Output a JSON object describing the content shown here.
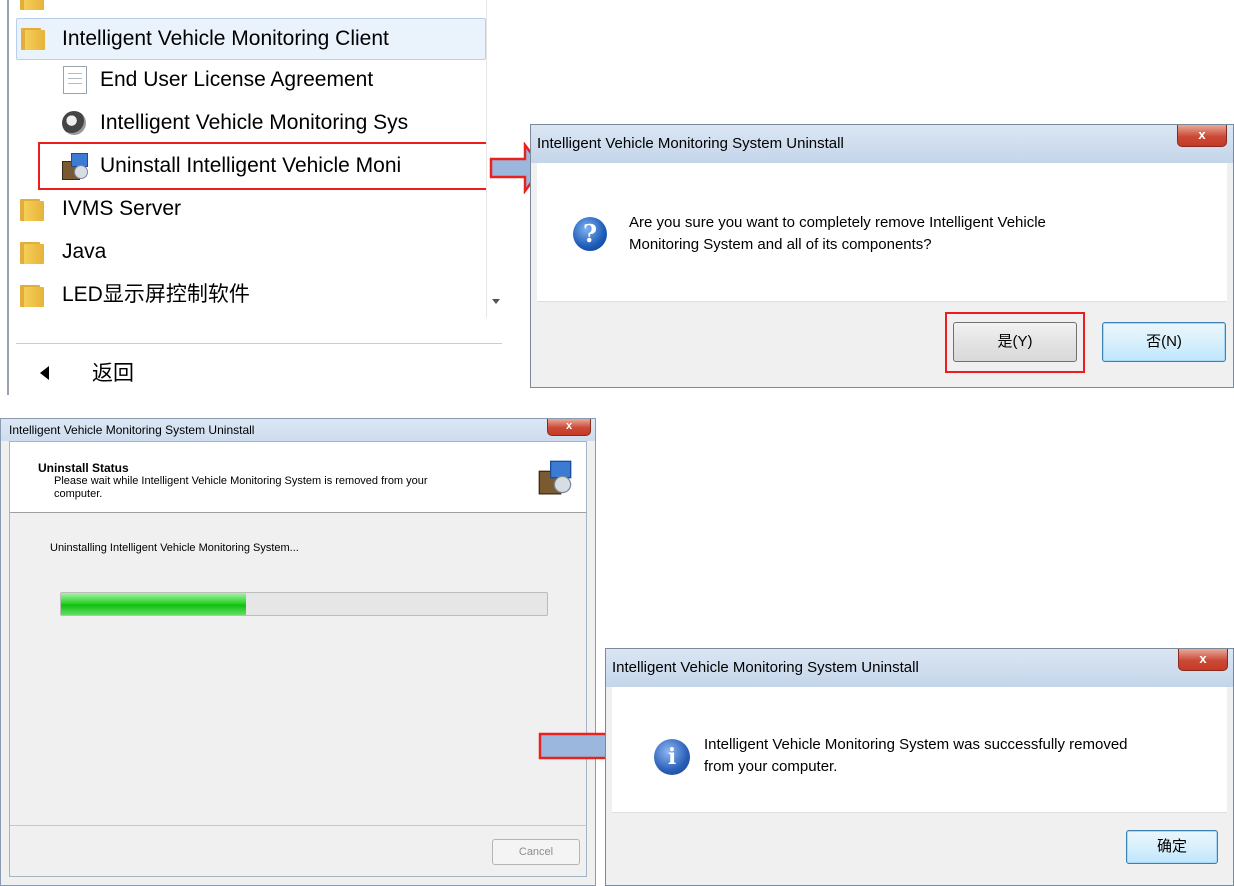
{
  "start_menu": {
    "folder_ivmc": "Intelligent Vehicle Monitoring Client",
    "items": [
      "End User License Agreement",
      "Intelligent Vehicle Monitoring Sys",
      "Uninstall Intelligent Vehicle Moni"
    ],
    "folders": [
      "IVMS Server",
      "Java",
      "LED显示屏控制软件"
    ],
    "back_label": "返回"
  },
  "confirm_dialog": {
    "title": "Intelligent Vehicle Monitoring System Uninstall",
    "close": "x",
    "message_line1": "Are you sure you want to completely remove Intelligent Vehicle",
    "message_line2": "Monitoring System and all of its components?",
    "yes_label": "是(Y)",
    "no_label": "否(N)",
    "icon": "question-icon"
  },
  "status_window": {
    "title": "Intelligent Vehicle Monitoring System Uninstall",
    "close": "x",
    "header_title": "Uninstall Status",
    "header_desc_line1": "Please wait while Intelligent Vehicle Monitoring System is removed from your",
    "header_desc_line2": "computer.",
    "status_text": "Uninstalling Intelligent Vehicle Monitoring System...",
    "progress": 0.38,
    "cancel_label": "Cancel"
  },
  "success_dialog": {
    "title": "Intelligent Vehicle Monitoring System Uninstall",
    "close": "x",
    "message_line1": "Intelligent Vehicle Monitoring System was successfully removed",
    "message_line2": "from your computer.",
    "ok_label": "确定",
    "icon": "info-icon"
  },
  "colors": {
    "highlight": "#ee1d1d",
    "arrow_fill": "#9bb7de",
    "arrow_stroke": "#e8231f",
    "progress": "#22cc22"
  }
}
